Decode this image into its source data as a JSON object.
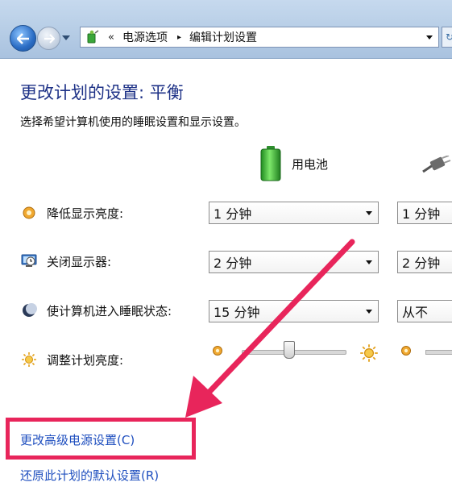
{
  "address_bar": {
    "overflow": "«",
    "segments": [
      "电源选项",
      "编辑计划设置"
    ],
    "separator": "▸"
  },
  "refresh_glyph": "↻",
  "page": {
    "title": "更改计划的设置: 平衡",
    "description": "选择希望计算机使用的睡眠设置和显示设置。"
  },
  "columns": {
    "battery_label": "用电池"
  },
  "settings": [
    {
      "label": "降低显示亮度:",
      "battery": "1 分钟",
      "plugged": "1 分钟",
      "icon": "dim-display-icon"
    },
    {
      "label": "关闭显示器:",
      "battery": "2 分钟",
      "plugged": "2 分钟",
      "icon": "monitor-off-icon"
    },
    {
      "label": "使计算机进入睡眠状态:",
      "battery": "15 分钟",
      "plugged": "从不",
      "icon": "sleep-moon-icon"
    }
  ],
  "brightness": {
    "label": "调整计划亮度:",
    "battery_level": 0.45
  },
  "links": {
    "advanced": "更改高级电源设置(C)",
    "restore": "还原此计划的默认设置(R)"
  },
  "colors": {
    "title": "#1e3287",
    "link": "#1f4fbf",
    "annotation": "#e8255b"
  }
}
